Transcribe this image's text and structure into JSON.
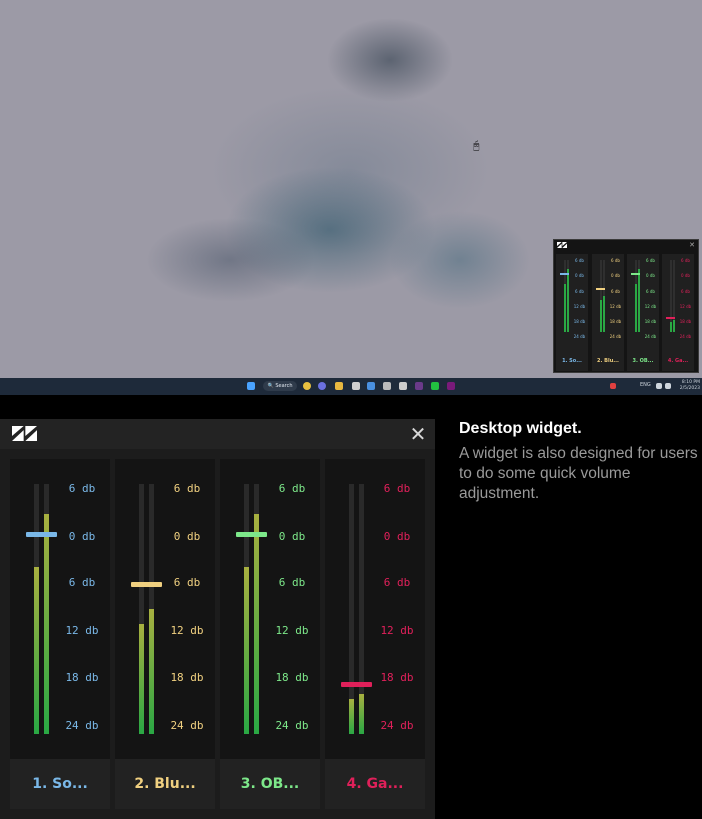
{
  "desktop": {
    "taskbar": {
      "search_label": "Search",
      "language": "ENG",
      "time": "8:10 PM",
      "date": "2/5/2023"
    }
  },
  "widget": {
    "close_icon": "close-icon",
    "logo_icon": "app-logo-icon",
    "ticks": [
      "6 db",
      "0 db",
      "6 db",
      "12 db",
      "18 db",
      "24 db"
    ],
    "channels": [
      {
        "label": "1. So...",
        "color": "#7ab8e8",
        "volume_level": 0.8,
        "meter_left": 0.67,
        "meter_right": 0.88
      },
      {
        "label": "2. Blu...",
        "color": "#f0d080",
        "volume_level": 0.6,
        "meter_left": 0.44,
        "meter_right": 0.5
      },
      {
        "label": "3. OB...",
        "color": "#7de88a",
        "volume_level": 0.8,
        "meter_left": 0.67,
        "meter_right": 0.88
      },
      {
        "label": "4. Ga...",
        "color": "#e0205a",
        "volume_level": 0.2,
        "meter_left": 0.14,
        "meter_right": 0.16
      }
    ],
    "meter_colors": {
      "fill_bottom": "#2aa844",
      "fill_top": "#a8b040"
    }
  },
  "caption": {
    "title": "Desktop widget.",
    "text": "A widget is also designed for users to do some quick volume adjustment."
  }
}
